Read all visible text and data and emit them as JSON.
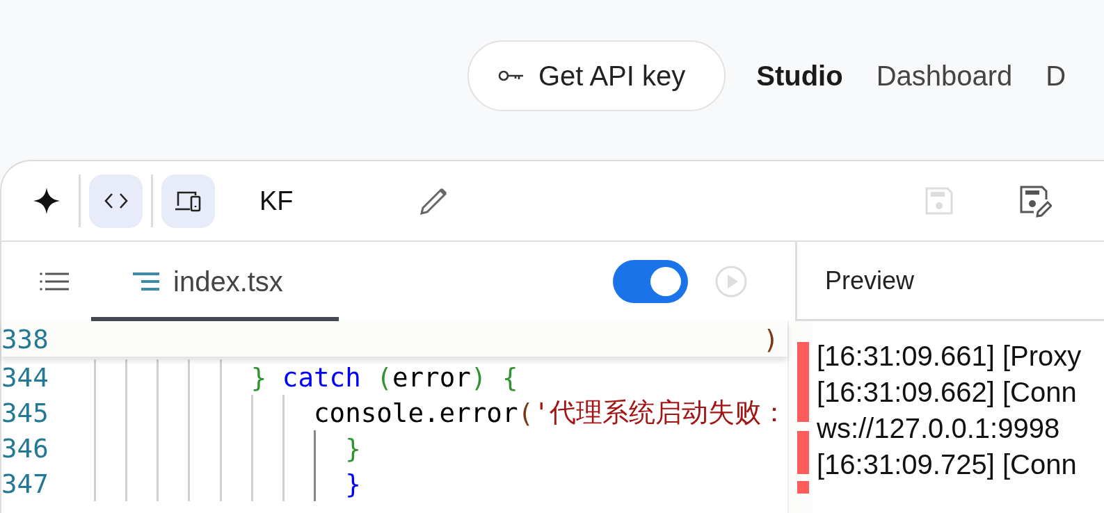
{
  "header": {
    "api_button": "Get API key",
    "nav": [
      {
        "label": "Studio",
        "selected": true
      },
      {
        "label": "Dashboard",
        "selected": false
      },
      {
        "label": "D",
        "selected": false
      }
    ]
  },
  "toolbar": {
    "project_name": "KF",
    "code_view_selected": true,
    "device_view_selected": true,
    "save_disabled": true
  },
  "editor": {
    "file_tab": {
      "label": "index.tsx",
      "selected": true
    },
    "autorun_toggle": {
      "on": true
    },
    "sticky_line": {
      "number": "338",
      "tokens": [
        {
          "kind": "paren",
          "text": ")"
        }
      ]
    },
    "lines": [
      {
        "number": "344",
        "guides": [
          {
            "active": false
          },
          {
            "active": false
          },
          {
            "active": false
          },
          {
            "active": false
          },
          {
            "active": false
          }
        ],
        "tokens": [
          {
            "kind": "brace",
            "text": "} "
          },
          {
            "kind": "keyword",
            "text": "catch "
          },
          {
            "kind": "brace",
            "text": "("
          },
          {
            "kind": "plain",
            "text": "error"
          },
          {
            "kind": "brace",
            "text": ") "
          },
          {
            "kind": "brace",
            "text": "{"
          }
        ]
      },
      {
        "number": "345",
        "guides": [
          {
            "active": false
          },
          {
            "active": false
          },
          {
            "active": false
          },
          {
            "active": false
          },
          {
            "active": false
          },
          {
            "active": false
          },
          {
            "active": false
          }
        ],
        "tokens": [
          {
            "kind": "plain",
            "text": "console.error"
          },
          {
            "kind": "paren",
            "text": "("
          },
          {
            "kind": "string",
            "text": "'代理系统启动失败："
          }
        ]
      },
      {
        "number": "346",
        "guides": [
          {
            "active": false
          },
          {
            "active": false
          },
          {
            "active": false
          },
          {
            "active": false
          },
          {
            "active": false
          },
          {
            "active": false
          },
          {
            "active": false
          },
          {
            "active": true
          }
        ],
        "tokens": [
          {
            "kind": "brace",
            "text": "}"
          }
        ]
      },
      {
        "number": "347",
        "guides": [
          {
            "active": false
          },
          {
            "active": false
          },
          {
            "active": false
          },
          {
            "active": false
          },
          {
            "active": false
          },
          {
            "active": false
          },
          {
            "active": false
          },
          {
            "active": true
          }
        ],
        "tokens": [
          {
            "kind": "keyword-brace",
            "text": "}"
          }
        ]
      }
    ]
  },
  "preview": {
    "title": "Preview",
    "log_lines": [
      "[16:31:09.661] [Proxy",
      "[16:31:09.662] [Conn",
      "ws://127.0.0.1:9998",
      "[16:31:09.725] [Conn"
    ]
  }
}
